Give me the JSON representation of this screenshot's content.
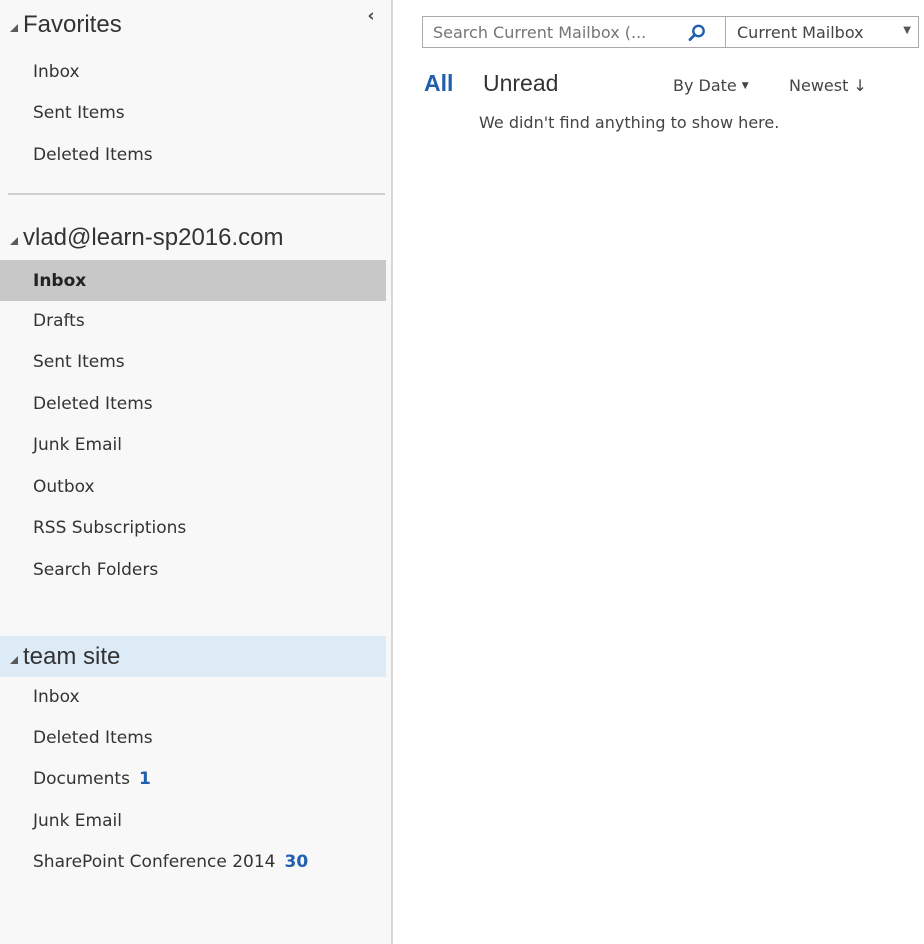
{
  "folder_pane": {
    "collapse_glyph": "‹",
    "favorites": {
      "title": "Favorites",
      "items": [
        "Inbox",
        "Sent Items",
        "Deleted Items"
      ]
    },
    "mailbox": {
      "title": "vlad@learn-sp2016.com",
      "items": [
        "Inbox",
        "Drafts",
        "Sent Items",
        "Deleted Items",
        "Junk Email",
        "Outbox",
        "RSS Subscriptions",
        "Search Folders"
      ],
      "active_item": "Inbox"
    },
    "team_site": {
      "title": "team site",
      "items": [
        {
          "label": "Inbox",
          "count": ""
        },
        {
          "label": "Deleted Items",
          "count": ""
        },
        {
          "label": "Documents",
          "count": "1"
        },
        {
          "label": "Junk Email",
          "count": ""
        },
        {
          "label": "SharePoint Conference 2014",
          "count": "30"
        }
      ]
    }
  },
  "search": {
    "placeholder": "Search Current Mailbox (...",
    "scope": "Current Mailbox"
  },
  "filters": {
    "all": "All",
    "unread": "Unread",
    "sort_by": "By Date",
    "sort_order": "Newest",
    "sort_arrow": "↓"
  },
  "message_list": {
    "empty_text": "We didn't find anything to show here."
  },
  "colors": {
    "accent": "#1f5fae",
    "selected_group": "#dcebf6",
    "active_folder": "#c8c8c8"
  }
}
